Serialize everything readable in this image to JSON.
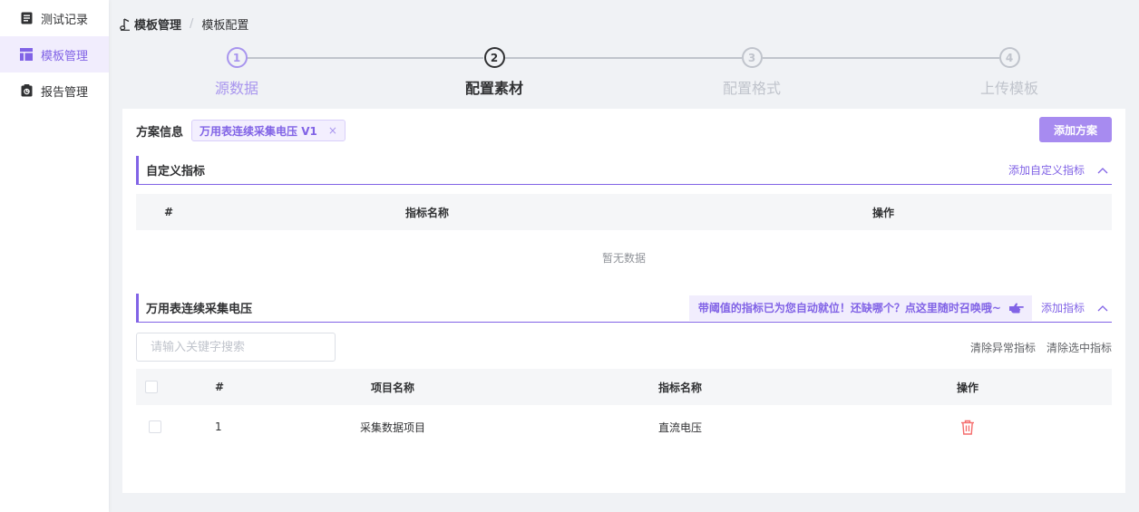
{
  "sidebar": {
    "items": [
      {
        "label": "测试记录",
        "icon": "document-icon"
      },
      {
        "label": "模板管理",
        "icon": "template-icon",
        "active": true
      },
      {
        "label": "报告管理",
        "icon": "report-icon"
      }
    ]
  },
  "breadcrumb": {
    "first": "模板管理",
    "separator": "/",
    "current": "模板配置"
  },
  "steps": [
    {
      "num": "1",
      "label": "源数据",
      "state": "done"
    },
    {
      "num": "2",
      "label": "配置素材",
      "state": "active"
    },
    {
      "num": "3",
      "label": "配置格式",
      "state": "wait"
    },
    {
      "num": "4",
      "label": "上传模板",
      "state": "wait"
    }
  ],
  "plan": {
    "label": "方案信息",
    "tag": "万用表连续采集电压 V1",
    "tag_close": "×",
    "add_button": "添加方案"
  },
  "custom_section": {
    "title": "自定义指标",
    "add_link": "添加自定义指标",
    "columns": [
      "#",
      "指标名称",
      "操作"
    ],
    "empty_text": "暂无数据"
  },
  "metric_section": {
    "title": "万用表连续采集电压",
    "hint": "带阈值的指标已为您自动就位！还缺哪个？点这里随时召唤哦~",
    "add_link": "添加指标",
    "search_placeholder": "请输入关键字搜索",
    "clear_abnormal": "清除异常指标",
    "clear_selected": "清除选中指标",
    "columns": [
      "#",
      "项目名称",
      "指标名称",
      "操作"
    ],
    "rows": [
      {
        "index": "1",
        "project": "采集数据项目",
        "metric": "直流电压"
      }
    ]
  },
  "colors": {
    "accent": "#8163e6",
    "accent_light": "#a78bf0",
    "danger": "#f56c6c"
  }
}
